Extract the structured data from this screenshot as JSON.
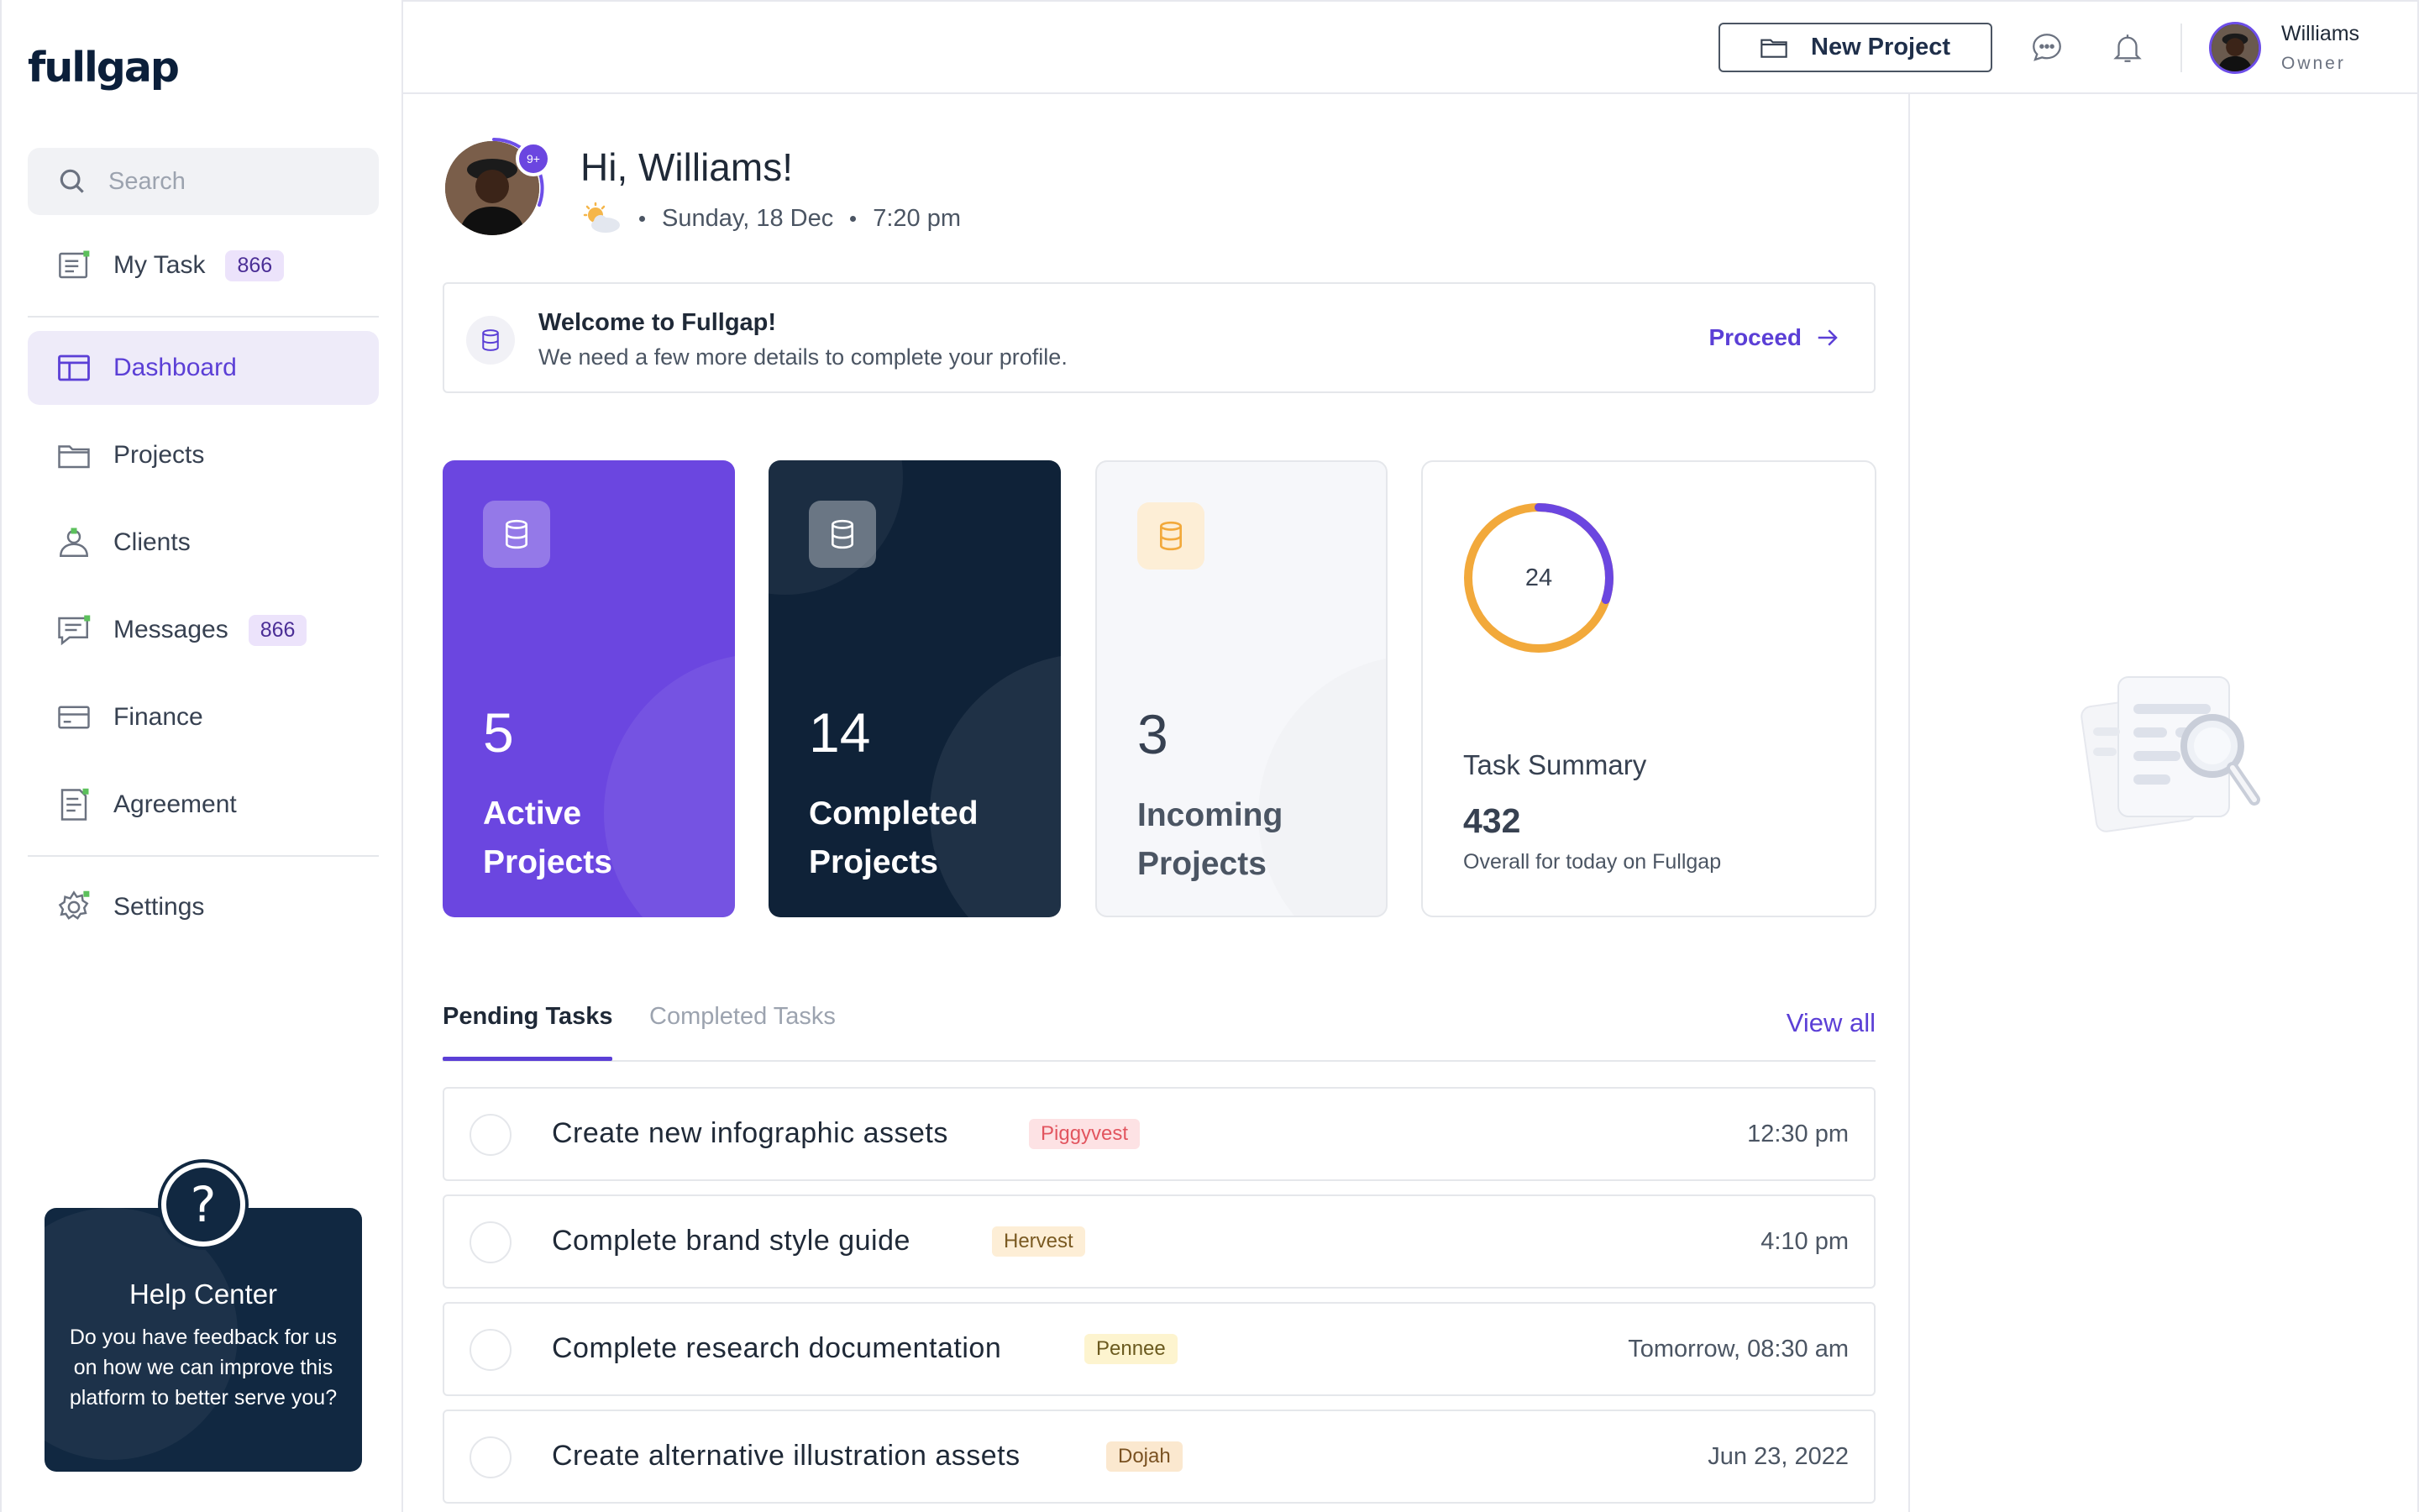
{
  "brand": {
    "logo": "fullgap"
  },
  "search": {
    "placeholder": "Search"
  },
  "sidebar": {
    "items": [
      {
        "label": "My Task",
        "badge": "866"
      },
      {
        "label": "Dashboard"
      },
      {
        "label": "Projects"
      },
      {
        "label": "Clients"
      },
      {
        "label": "Messages",
        "badge": "866"
      },
      {
        "label": "Finance"
      },
      {
        "label": "Agreement"
      },
      {
        "label": "Settings"
      }
    ]
  },
  "help": {
    "icon": "?",
    "title": "Help Center",
    "text": "Do you have feedback for us on how we can improve this platform to better serve you?"
  },
  "topbar": {
    "new_project": "New Project",
    "user_name": "Williams",
    "user_role": "Owner"
  },
  "header": {
    "notif_count": "9+",
    "greeting": "Hi, Williams!",
    "date": "Sunday, 18 Dec",
    "time": "7:20 pm",
    "weather_icon": "partly-cloudy-icon"
  },
  "welcome": {
    "title": "Welcome to Fullgap!",
    "subtitle": "We need a few more details to complete your profile.",
    "action": "Proceed"
  },
  "stats": [
    {
      "value": "5",
      "label_1": "Active",
      "label_2": "Projects"
    },
    {
      "value": "14",
      "label_1": "Completed",
      "label_2": "Projects"
    },
    {
      "value": "3",
      "label_1": "Incoming",
      "label_2": "Projects"
    }
  ],
  "summary": {
    "ring_value": "24",
    "ring_fraction": 0.3,
    "title": "Task Summary",
    "total": "432",
    "caption": "Overall for today on Fullgap"
  },
  "tasks_tabs": {
    "pending": "Pending Tasks",
    "completed": "Completed Tasks",
    "view_all": "View all"
  },
  "tasks": [
    {
      "title": "Create new infographic assets",
      "tag": "Piggyvest",
      "time": "12:30 pm"
    },
    {
      "title": "Complete brand style guide",
      "tag": "Hervest",
      "time": "4:10 pm"
    },
    {
      "title": "Complete research documentation",
      "tag": "Pennee",
      "time": "Tomorrow, 08:30 am"
    },
    {
      "title": "Create alternative illustration assets",
      "tag": "Dojah",
      "time": "Jun 23, 2022"
    }
  ],
  "colors": {
    "accent": "#5b3fd6",
    "dark": "#0f2238",
    "orange": "#f2a93b"
  }
}
